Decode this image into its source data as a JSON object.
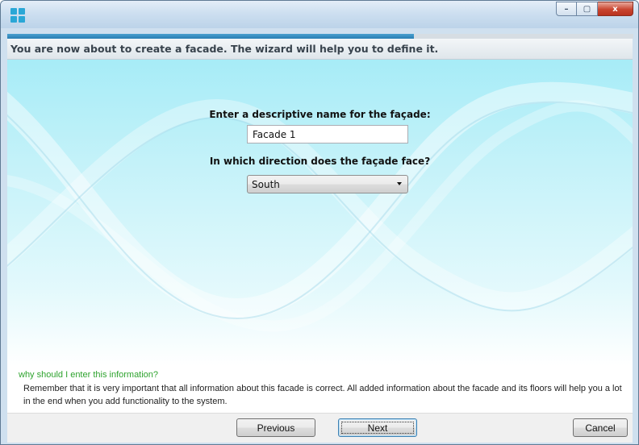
{
  "window": {
    "controls": {
      "minimize": "–",
      "maximize": "▢",
      "close": "x"
    },
    "icon": "app-grid-icon"
  },
  "wizard": {
    "progress": 0.65,
    "header": "You are now about to create a facade. The wizard will help you to define it."
  },
  "form": {
    "name_label": "Enter a descriptive name for the façade:",
    "name_value": "Facade 1",
    "direction_label": "In which direction does the façade face?",
    "direction_value": "South"
  },
  "help": {
    "title": "why should I enter this information?",
    "body": "Remember that it is very important that all information about this facade is correct. All added information about the facade and its floors will help you a lot in the end when you add functionality to the system."
  },
  "buttons": {
    "previous": "Previous",
    "next": "Next",
    "cancel": "Cancel"
  }
}
